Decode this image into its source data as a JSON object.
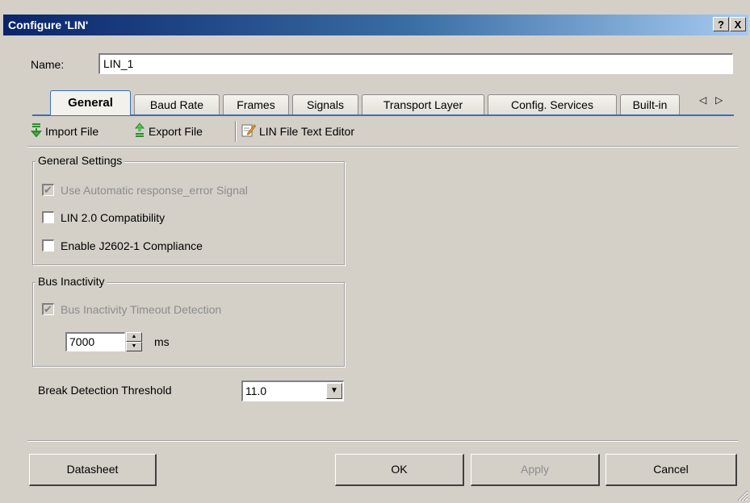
{
  "window": {
    "title": "Configure 'LIN'",
    "help_label": "?",
    "close_label": "X"
  },
  "name_field": {
    "label": "Name:",
    "value": "LIN_1"
  },
  "tabs": [
    {
      "label": "General",
      "active": true
    },
    {
      "label": "Baud Rate"
    },
    {
      "label": "Frames"
    },
    {
      "label": "Signals"
    },
    {
      "label": "Transport Layer"
    },
    {
      "label": "Config. Services"
    },
    {
      "label": "Built-in"
    }
  ],
  "tab_scroll": {
    "left": "◁",
    "right": "▷"
  },
  "toolbar": {
    "import_label": "Import File",
    "export_label": "Export File",
    "editor_label": "LIN File Text Editor"
  },
  "general_settings": {
    "title": "General Settings",
    "auto_response_label": "Use Automatic response_error Signal",
    "lin20_label": "LIN 2.0 Compatibility",
    "j2602_label": "Enable J2602-1 Compliance"
  },
  "bus_inactivity": {
    "title": "Bus Inactivity",
    "timeout_label": "Bus Inactivity Timeout Detection",
    "timeout_value": "7000",
    "unit": "ms"
  },
  "break_detection": {
    "label": "Break Detection Threshold",
    "value": "11.0"
  },
  "buttons": {
    "datasheet": "Datasheet",
    "ok": "OK",
    "apply": "Apply",
    "cancel": "Cancel"
  },
  "colors": {
    "titlebar_start": "#0a246a",
    "titlebar_end": "#a6caf0",
    "dialog_bg": "#d4d0c8",
    "tab_accent": "#3c6fb4"
  }
}
